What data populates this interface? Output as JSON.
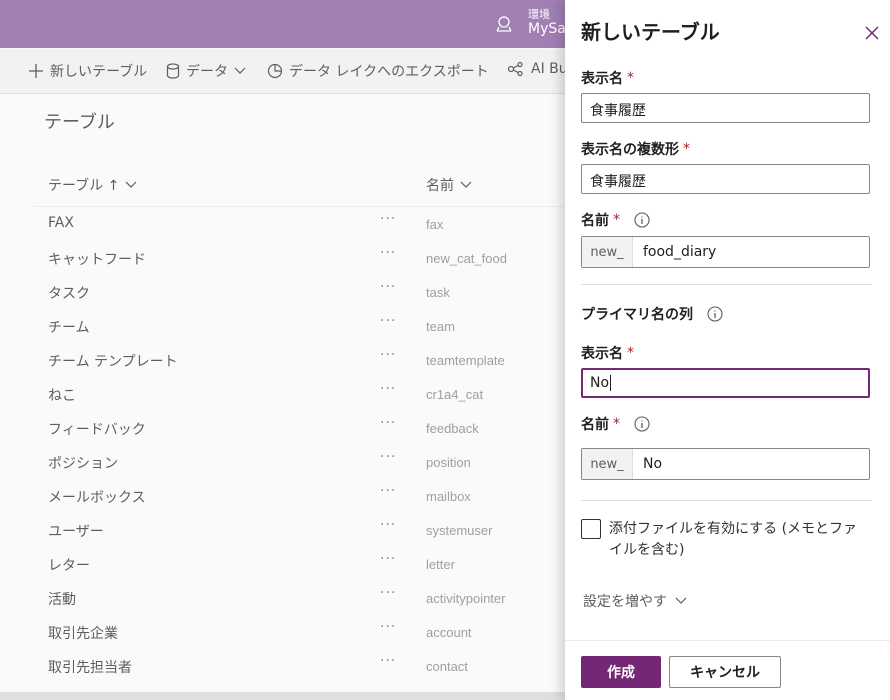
{
  "header": {
    "env_label": "環境",
    "env_name": "MySan"
  },
  "commands": [
    {
      "label": "新しいテーブル",
      "icon": "plus-icon"
    },
    {
      "label": "データ",
      "icon": "database-icon"
    },
    {
      "label": "データ レイクへのエクスポート",
      "icon": "export-icon"
    },
    {
      "label": "AI Bu",
      "icon": "ai-builder-icon"
    }
  ],
  "main": {
    "title": "テーブル",
    "columns": {
      "table": "テーブル ↑",
      "name": "名前"
    },
    "more_glyph": "···",
    "rows": [
      {
        "display": "FAX",
        "schema": "fax"
      },
      {
        "display": "キャットフード",
        "schema": "new_cat_food"
      },
      {
        "display": "タスク",
        "schema": "task"
      },
      {
        "display": "チーム",
        "schema": "team"
      },
      {
        "display": "チーム テンプレート",
        "schema": "teamtemplate"
      },
      {
        "display": "ねこ",
        "schema": "cr1a4_cat"
      },
      {
        "display": "フィードバック",
        "schema": "feedback"
      },
      {
        "display": "ポジション",
        "schema": "position"
      },
      {
        "display": "メールボックス",
        "schema": "mailbox"
      },
      {
        "display": "ユーザー",
        "schema": "systemuser"
      },
      {
        "display": "レター",
        "schema": "letter"
      },
      {
        "display": "活動",
        "schema": "activitypointer"
      },
      {
        "display": "取引先企業",
        "schema": "account"
      },
      {
        "display": "取引先担当者",
        "schema": "contact"
      }
    ]
  },
  "panel": {
    "title": "新しいテーブル",
    "required_mark": "*",
    "display_name_label": "表示名",
    "display_name_value": "食事履歴",
    "plural_label": "表示名の複数形",
    "plural_value": "食事履歴",
    "name_label": "名前",
    "prefix": "new_",
    "name_value": "food_diary",
    "primary_section": "プライマリ名の列",
    "primary_display_label": "表示名",
    "primary_display_value": "No",
    "primary_name_label": "名前",
    "primary_prefix": "new_",
    "primary_name_value": "No",
    "attachments_label": "添付ファイルを有効にする (メモとファイルを含む)",
    "attachments_checked": false,
    "more_settings": "設定を増やす",
    "create_button": "作成",
    "cancel_button": "キャンセル"
  },
  "colors": {
    "accent": "#742774",
    "topbar": "#a17fb3",
    "required": "#a4262c"
  }
}
